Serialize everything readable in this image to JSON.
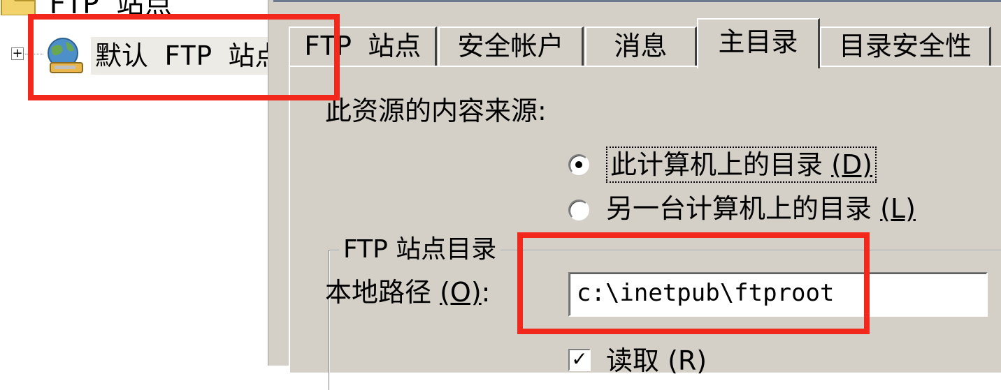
{
  "tree": {
    "root_label": "FTP 站点",
    "expander_symbol": "+",
    "selected_item_label": "默认 FTP 站点"
  },
  "tabs": [
    {
      "label": "FTP 站点",
      "active": false
    },
    {
      "label": "安全帐户",
      "active": false
    },
    {
      "label": "消息",
      "active": false
    },
    {
      "label": "主目录",
      "active": true
    },
    {
      "label": "目录安全性",
      "active": false
    }
  ],
  "home_directory": {
    "content_source_label": "此资源的内容来源:",
    "radio_local": {
      "text": "此计算机上的目录 ",
      "accesskey": "(D)",
      "selected": true
    },
    "radio_remote": {
      "text": "另一台计算机上的目录 ",
      "accesskey": "(L)",
      "selected": false
    },
    "group_title": "FTP 站点目录",
    "local_path_label_text": "本地路径 ",
    "local_path_accesskey": "(O)",
    "local_path_colon": ":",
    "local_path_value": "c:\\inetpub\\ftproot",
    "read_checkbox": {
      "label": "读取 (R)",
      "checked": true,
      "mark": "✓"
    }
  },
  "colors": {
    "annotation_red": "#f1281b",
    "dialog_bg": "#d4d0c8"
  }
}
